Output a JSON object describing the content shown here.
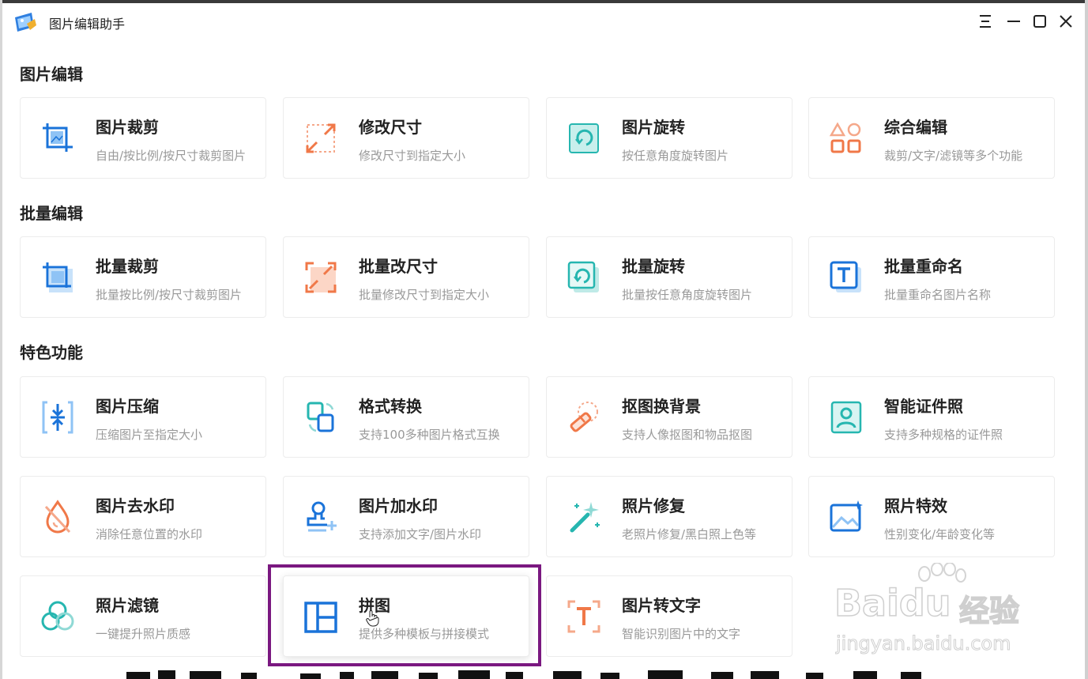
{
  "app": {
    "title": "图片编辑助手"
  },
  "sections": {
    "image_edit": "图片编辑",
    "batch_edit": "批量编辑",
    "features": "特色功能"
  },
  "cards": {
    "crop": {
      "title": "图片裁剪",
      "desc": "自由/按比例/按尺寸裁剪图片"
    },
    "resize": {
      "title": "修改尺寸",
      "desc": "修改尺寸到指定大小"
    },
    "rotate": {
      "title": "图片旋转",
      "desc": "按任意角度旋转图片"
    },
    "composite": {
      "title": "综合编辑",
      "desc": "裁剪/文字/滤镜等多个功能"
    },
    "batch_crop": {
      "title": "批量裁剪",
      "desc": "批量按比例/按尺寸裁剪图片"
    },
    "batch_resize": {
      "title": "批量改尺寸",
      "desc": "批量修改尺寸到指定大小"
    },
    "batch_rotate": {
      "title": "批量旋转",
      "desc": "批量按任意角度旋转图片"
    },
    "batch_rename": {
      "title": "批量重命名",
      "desc": "批量重命名图片名称"
    },
    "compress": {
      "title": "图片压缩",
      "desc": "压缩图片至指定大小"
    },
    "convert": {
      "title": "格式转换",
      "desc": "支持100多种图片格式互换"
    },
    "cutout": {
      "title": "抠图换背景",
      "desc": "支持人像抠图和物品抠图"
    },
    "id_photo": {
      "title": "智能证件照",
      "desc": "支持多种规格的证件照"
    },
    "remove_wm": {
      "title": "图片去水印",
      "desc": "消除任意位置的水印"
    },
    "add_wm": {
      "title": "图片加水印",
      "desc": "支持添加文字/图片水印"
    },
    "restore": {
      "title": "照片修复",
      "desc": "老照片修复/黑白照上色等"
    },
    "effects": {
      "title": "照片特效",
      "desc": "性别变化/年龄变化等"
    },
    "filters": {
      "title": "照片滤镜",
      "desc": "一键提升照片质感"
    },
    "collage": {
      "title": "拼图",
      "desc": "提供多种模板与拼接模式"
    },
    "ocr": {
      "title": "图片转文字",
      "desc": "智能识别图片中的文字"
    }
  },
  "watermark": {
    "brand": "Baidu",
    "cn": "经验",
    "url": "jingyan.baidu.com"
  },
  "colors": {
    "blue": "#1a73d9",
    "orange": "#f07848",
    "teal": "#26b6b0",
    "highlight": "#7a1880"
  }
}
